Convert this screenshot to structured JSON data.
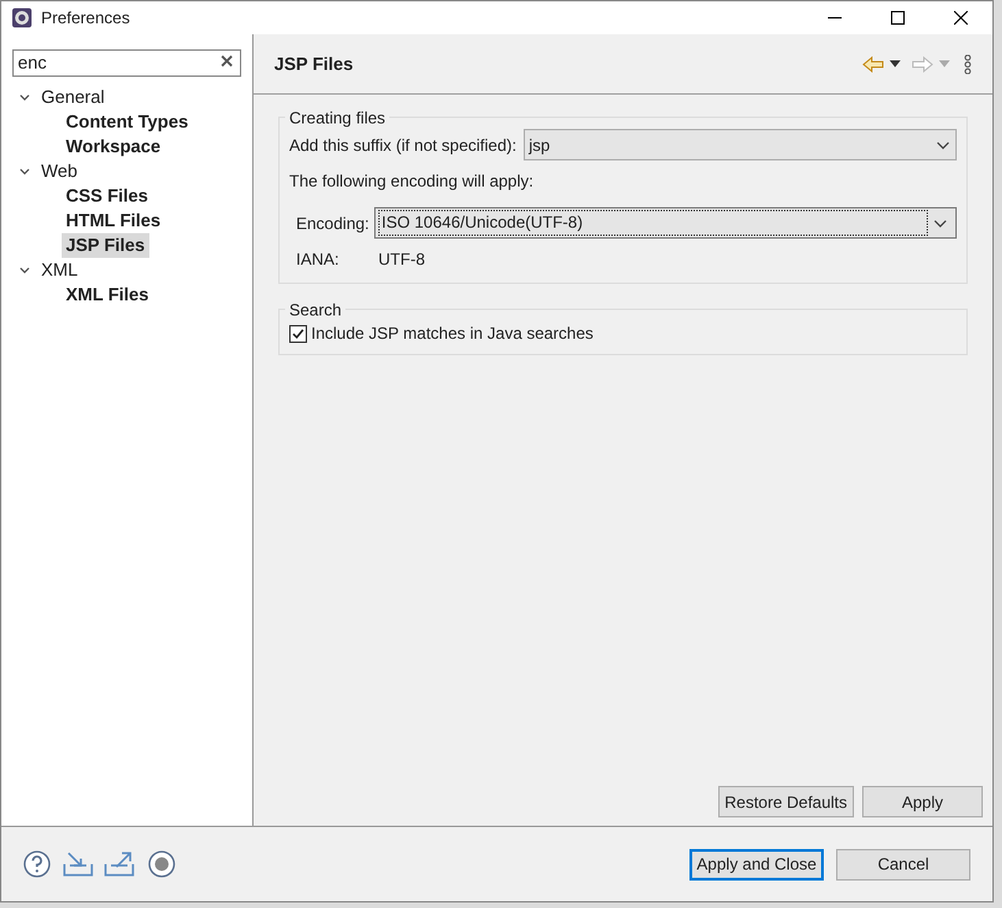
{
  "window": {
    "title": "Preferences"
  },
  "filter": {
    "value": "enc"
  },
  "tree": [
    {
      "label": "General",
      "expanded": true,
      "selected": false,
      "children": [
        {
          "label": "Content Types",
          "selected": false
        },
        {
          "label": "Workspace",
          "selected": false
        }
      ]
    },
    {
      "label": "Web",
      "expanded": true,
      "selected": false,
      "children": [
        {
          "label": "CSS Files",
          "selected": false
        },
        {
          "label": "HTML Files",
          "selected": false
        },
        {
          "label": "JSP Files",
          "selected": true
        }
      ]
    },
    {
      "label": "XML",
      "expanded": true,
      "selected": false,
      "children": [
        {
          "label": "XML Files",
          "selected": false
        }
      ]
    }
  ],
  "page": {
    "title": "JSP Files",
    "creating": {
      "legend": "Creating files",
      "suffix_label": "Add this suffix (if not specified):",
      "suffix_value": "jsp",
      "note": "The following encoding will apply:",
      "encoding_label": "Encoding:",
      "encoding_value": "ISO 10646/Unicode(UTF-8)",
      "iana_label": "IANA:",
      "iana_value": "UTF-8"
    },
    "search": {
      "legend": "Search",
      "checkbox": {
        "label": "Include JSP matches in Java searches",
        "checked": true
      }
    },
    "buttons": [
      "Restore Defaults",
      "Apply"
    ]
  },
  "footer_buttons": [
    {
      "label": "Apply and Close",
      "default": true
    },
    {
      "label": "Cancel",
      "default": false
    }
  ]
}
